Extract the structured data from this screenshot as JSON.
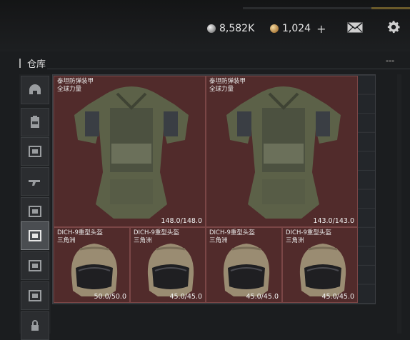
{
  "currencies": [
    {
      "icon": "silver-coin-icon",
      "value": "8,582K"
    },
    {
      "icon": "gold-coin-icon",
      "value": "1,024"
    }
  ],
  "add_label": "+",
  "section": {
    "title": "仓库"
  },
  "sidebar_icons": [
    "helmet-icon",
    "backpack-icon",
    "storage-icon",
    "rifle-icon",
    "storage-icon",
    "storage-icon",
    "storage-icon",
    "storage-icon",
    "lock-icon"
  ],
  "items": [
    {
      "name": "泰坦防弹装甲",
      "sub": "全球力量",
      "durability": "148.0/148.0"
    },
    {
      "name": "泰坦防弹装甲",
      "sub": "全球力量",
      "durability": "143.0/143.0"
    },
    {
      "name": "DICH-9重型头盔",
      "sub": "三角洲",
      "durability": "50.0/50.0"
    },
    {
      "name": "DICH-9重型头盔",
      "sub": "三角洲",
      "durability": "45.0/45.0"
    },
    {
      "name": "DICH-9重型头盔",
      "sub": "三角洲",
      "durability": "45.0/45.0"
    },
    {
      "name": "DICH-9重型头盔",
      "sub": "三角洲",
      "durability": "45.0/45.0"
    }
  ]
}
